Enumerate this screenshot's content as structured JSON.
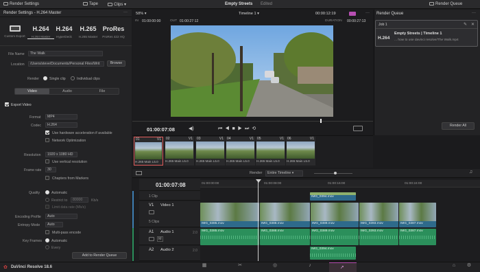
{
  "topbar": {
    "render_settings": "Render Settings",
    "tape": "Tape",
    "clips": "Clips",
    "project_title": "Empty Streets",
    "edited": "Edited",
    "render_queue": "Render Queue"
  },
  "settings": {
    "title": "Render Settings - H.264 Master",
    "presets": [
      {
        "name": "",
        "sub": "Custom Export"
      },
      {
        "name": "H.264",
        "sub": "H.264 Master"
      },
      {
        "name": "H.264",
        "sub": "HyperDeck"
      },
      {
        "name": "H.265",
        "sub": "H.265 Master"
      },
      {
        "name": "ProRes",
        "sub": "ProRes 422 HQ"
      }
    ],
    "file_name_label": "File Name",
    "file_name": "The Walk",
    "location_label": "Location",
    "location": "/Users/steve/Documents/Personal Files/Writ",
    "browse": "Browse",
    "render_label": "Render",
    "single_clip": "Single clip",
    "individual_clips": "Individual clips",
    "tabs": [
      "Video",
      "Audio",
      "File"
    ],
    "export_video": "Export Video",
    "format_label": "Format",
    "format": "MP4",
    "codec_label": "Codec",
    "codec": "H.264",
    "hw_accel": "Use hardware acceleration if available",
    "net_opt": "Network Optimization",
    "resolution_label": "Resolution",
    "resolution": "1920 x 1080 HD",
    "vert_res": "Use vertical resolution",
    "framerate_label": "Frame rate",
    "framerate": "30",
    "chapters": "Chapters from Markers",
    "quality_label": "Quality",
    "automatic": "Automatic",
    "restrict_to": "Restrict to",
    "restrict_val": "80000",
    "kbs": "Kb/s",
    "limit_text": "Limit data rate (Mb/s)",
    "encoding_profile_label": "Encoding Profile",
    "encoding_profile": "Auto",
    "entropy_mode_label": "Entropy Mode",
    "entropy_mode": "Auto",
    "multipass": "Multi-pass encode",
    "key_frames_label": "Key Frames",
    "key_frames": "Automatic",
    "frame_text": "Every",
    "add_btn": "Add to Render Queue"
  },
  "viewer": {
    "zoom": "58%",
    "timeline_name": "Timeline 1",
    "tc_top": "00:00:12:19",
    "in_label": "IN",
    "in_tc": "01:00:00:00",
    "out_label": "OUT",
    "out_tc": "01:00:27:12",
    "duration_label": "DURATION",
    "duration_tc": "00:00:27:13",
    "current_tc": "01:00:07:08"
  },
  "thumbs": [
    {
      "num": "01",
      "track": "V1",
      "cap": "H.265 Main L5.0"
    },
    {
      "num": "02",
      "track": "V1",
      "cap": "H.265 Main L5.0"
    },
    {
      "num": "03",
      "track": "V1",
      "cap": "H.265 Main L5.0"
    },
    {
      "num": "04",
      "track": "V1",
      "cap": "H.265 Main L5.0"
    },
    {
      "num": "05",
      "track": "V1",
      "cap": "H.265 Main L5.0"
    },
    {
      "num": "06",
      "track": "V1",
      "cap": "H.265 Main L5.0"
    }
  ],
  "timeline": {
    "render_label": "Render",
    "render_mode": "Entire Timeline",
    "tc": "01:00:07:08",
    "ruler": [
      "01:00:00:00",
      "01:00:08:00",
      "01:00:16:00",
      "01:00:24:00"
    ],
    "v2_clips": "1 Clip",
    "v1_name": "V1",
    "v1_label": "Video 1",
    "v1_clips": "5 Clips",
    "a1_name": "A1",
    "a1_label": "Audio 1",
    "a1_level": "2.0",
    "a2_name": "A2",
    "a2_label": "Audio 2",
    "a2_level": "2.0",
    "v2_clip": "IMG_0394.mov",
    "video_clips": [
      "IMG_0385.mov",
      "IMG_0388.mov",
      "IMG_0389.mov",
      "IMG_0393.mov",
      "IMG_0387.mov"
    ],
    "audio_clips": [
      "IMG_0385.mov",
      "IMG_0388.mov",
      "IMG_0389.mov",
      "IMG_0393.mov",
      "IMG_0387.mov"
    ],
    "a2_clip": "IMG_0394.mov"
  },
  "queue": {
    "title": "Render Queue",
    "job": "Job 1",
    "job_title": "Empty Streets | Timeline 1",
    "job_codec": "H.264",
    "job_path": "... how to use davinci resolve/The Walk.mp4",
    "render_all": "Render All"
  },
  "footer": {
    "app": "DaVinci Resolve 18.6"
  },
  "colors": {
    "accent": "#e05b5b",
    "video": "#2e6a8b",
    "audio": "#2b8f5b",
    "playhead": "#d0d0d0"
  }
}
